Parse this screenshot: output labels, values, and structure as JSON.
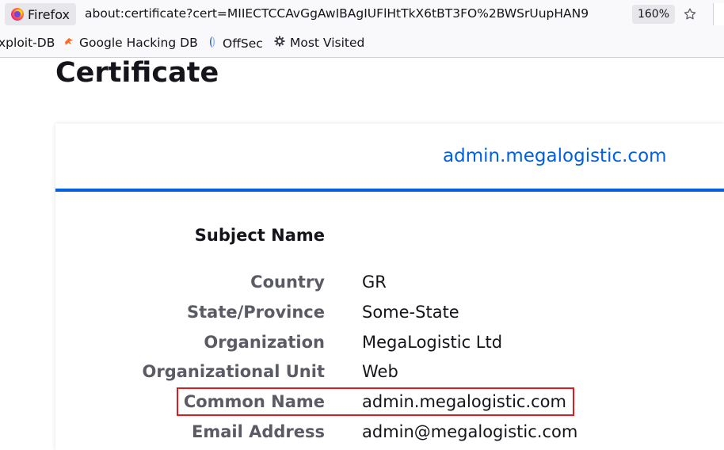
{
  "urlbar": {
    "identity_label": "Firefox",
    "url": "about:certificate?cert=MIIECTCCAvGgAwIBAgIUFlHtTkX6tBT3FO%2BWSrUupHAN9",
    "zoom": "160%",
    "bookmark_star_icon": "star-outline-icon"
  },
  "bookmarks": [
    {
      "label": "xploit-DB",
      "icon": ""
    },
    {
      "label": "Google Hacking DB",
      "icon": "google-hacking-db-icon"
    },
    {
      "label": "OffSec",
      "icon": "offsec-icon"
    },
    {
      "label": "Most Visited",
      "icon": "gear-icon"
    }
  ],
  "page": {
    "title": "Certificate",
    "tab_label": "admin.megalogistic.com",
    "accent_color": "#0060df",
    "highlight_color": "#e0191f"
  },
  "subject": {
    "section_title": "Subject Name",
    "fields": [
      {
        "label": "Country",
        "value": "GR"
      },
      {
        "label": "State/Province",
        "value": "Some-State"
      },
      {
        "label": "Organization",
        "value": "MegaLogistic Ltd"
      },
      {
        "label": "Organizational Unit",
        "value": "Web"
      },
      {
        "label": "Common Name",
        "value": "admin.megalogistic.com"
      },
      {
        "label": "Email Address",
        "value": "admin@megalogistic.com"
      }
    ]
  }
}
